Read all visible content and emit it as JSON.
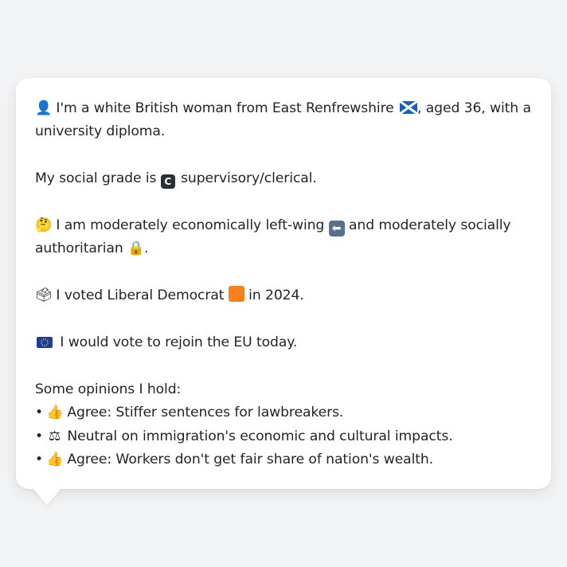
{
  "profile": {
    "line1_part1": "I'm a white British woman from East Renfrewshire",
    "line1_part2": ", aged 36, with a",
    "line1_cont": "university diploma.",
    "social_grade_prefix": "My social grade is",
    "social_grade_letter": "C",
    "social_grade_suffix": "supervisory/clerical.",
    "ideology_part1": "I am moderately economically left-wing",
    "ideology_part2": "and moderately socially",
    "ideology_cont": "authoritarian",
    "ideology_end": ".",
    "vote_part1": "I voted Liberal Democrat",
    "vote_part2": "in 2024.",
    "eu": "I would vote to rejoin the EU today.",
    "opinions_heading": "Some opinions I hold:",
    "opinions": [
      {
        "icon": "thumbs-up-icon",
        "text": "Agree: Stiffer sentences for lawbreakers."
      },
      {
        "icon": "balance-scale-icon",
        "text": "Neutral on immigration's economic and cultural impacts."
      },
      {
        "icon": "thumbs-up-icon",
        "text": "Agree: Workers don't get fair share of nation's wealth."
      }
    ]
  },
  "icons": {
    "person": "👤",
    "thinking": "🤔",
    "ballot": "🗳",
    "eu_flag": "🇪🇺",
    "thumbs_up": "👍",
    "scales": "⚖",
    "left_arrow": "⬅",
    "lock": "🔒",
    "bullet": "•"
  },
  "colors": {
    "background": "#f2f3f5",
    "card": "#ffffff",
    "text": "#1f2328",
    "libdem_orange": "#f5821f"
  }
}
